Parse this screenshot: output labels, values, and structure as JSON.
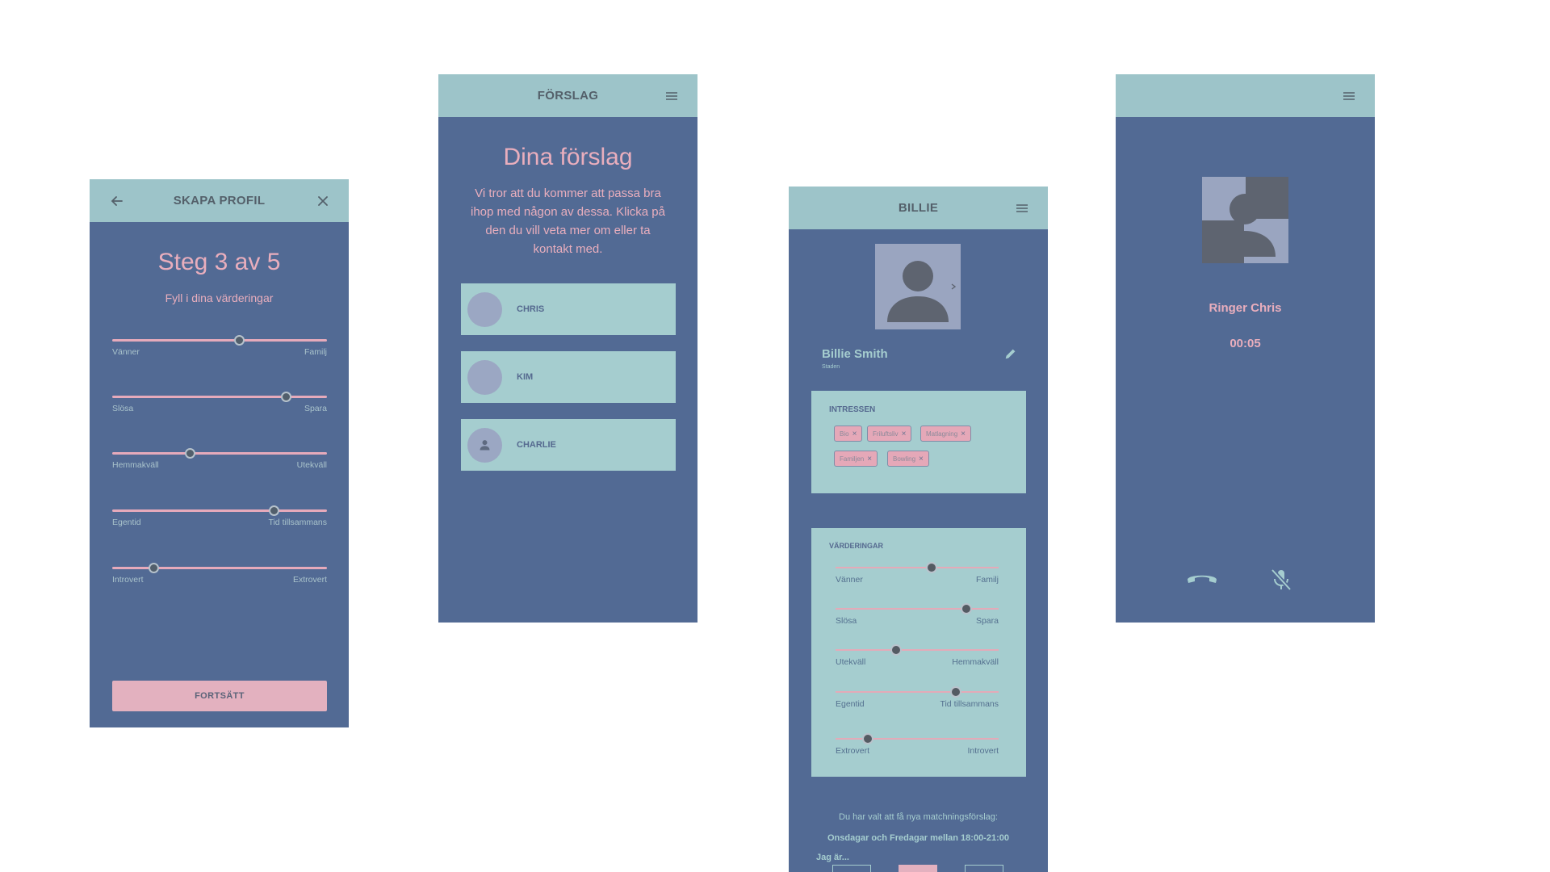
{
  "screen1": {
    "title": "SKAPA PROFIL",
    "heading": "Steg 3 av 5",
    "subheading": "Fyll i dina värderingar",
    "sliders": [
      {
        "left": "Vänner",
        "right": "Familj",
        "value": 0.59
      },
      {
        "left": "Slösa",
        "right": "Spara",
        "value": 0.81
      },
      {
        "left": "Hemmakväll",
        "right": "Utekväll",
        "value": 0.36
      },
      {
        "left": "Egentid",
        "right": "Tid tillsammans",
        "value": 0.75
      },
      {
        "left": "Introvert",
        "right": "Extrovert",
        "value": 0.19
      }
    ],
    "continue_label": "FORTSÄTT"
  },
  "screen2": {
    "title": "FÖRSLAG",
    "heading": "Dina förslag",
    "intro": "Vi tror att du kommer att passa bra ihop med någon av dessa. Klicka på den du vill veta mer om eller ta kontakt med.",
    "suggestions": [
      {
        "name": "CHRIS"
      },
      {
        "name": "KIM"
      },
      {
        "name": "CHARLIE"
      }
    ]
  },
  "screen3": {
    "title": "BILLIE",
    "name": "Billie Smith",
    "location": "Staden",
    "interests_title": "INTRESSEN",
    "interests": [
      "Bio",
      "Friluftsliv",
      "Matlagning",
      "Familjen",
      "Bowling"
    ],
    "values_title": "VÄRDERINGAR",
    "sliders": [
      {
        "left": "Vänner",
        "right": "Familj",
        "value": 0.59
      },
      {
        "left": "Slösa",
        "right": "Spara",
        "value": 0.8
      },
      {
        "left": "Utekväll",
        "right": "Hemmakväll",
        "value": 0.37
      },
      {
        "left": "Egentid",
        "right": "Tid tillsammans",
        "value": 0.74
      },
      {
        "left": "Extrovert",
        "right": "Introvert",
        "value": 0.2
      }
    ],
    "schedule_text": "Du har valt att få nya matchningsförslag:",
    "schedule_value": "Onsdagar och Fredagar mellan 18:00-21:00",
    "iam_label": "Jag är..."
  },
  "screen4": {
    "status": "Ringer Chris",
    "timer": "00:05"
  }
}
